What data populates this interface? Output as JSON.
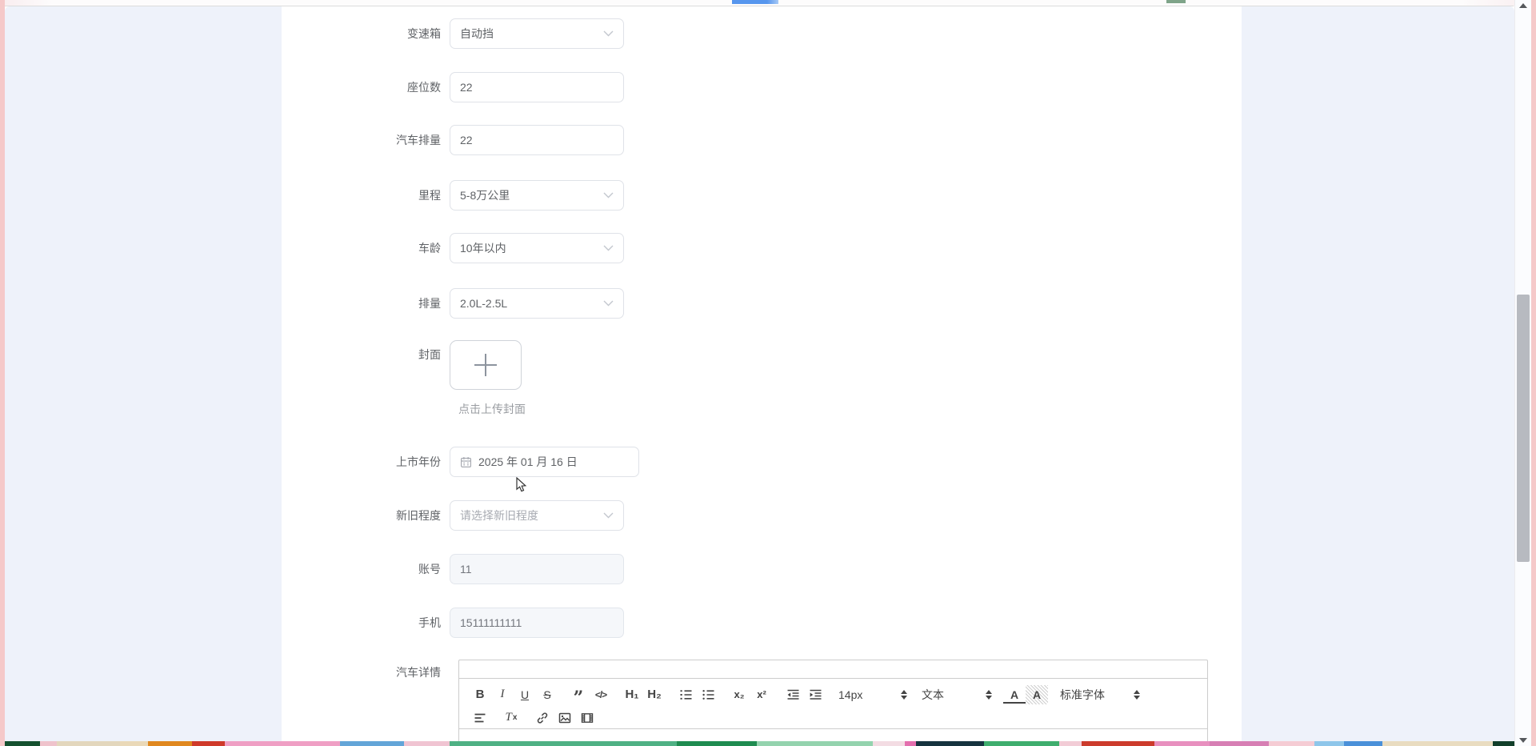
{
  "colors": {
    "panel_accent": "#eef2fa",
    "frame_pink": "#f5c9c9",
    "top_bar_blue": "#5796ee",
    "scrollbar_thumb": "#b7bac0",
    "input_border": "#dfe2e8",
    "disabled_bg": "#f5f7fa"
  },
  "form": {
    "transmission": {
      "label": "变速箱",
      "value": "自动挡"
    },
    "seats": {
      "label": "座位数",
      "value": "22"
    },
    "engine_displacement": {
      "label": "汽车排量",
      "value": "22"
    },
    "mileage": {
      "label": "里程",
      "value": "5-8万公里"
    },
    "car_age": {
      "label": "车龄",
      "value": "10年以内"
    },
    "displacement_range": {
      "label": "排量",
      "value": "2.0L-2.5L"
    },
    "cover": {
      "label": "封面",
      "hint": "点击上传封面"
    },
    "market_year": {
      "label": "上市年份",
      "value": "2025 年 01 月 16 日"
    },
    "condition": {
      "label": "新旧程度",
      "placeholder": "请选择新旧程度"
    },
    "account": {
      "label": "账号",
      "value": "11"
    },
    "phone": {
      "label": "手机",
      "value": "15111111111"
    },
    "car_detail": {
      "label": "汽车详情"
    }
  },
  "editor": {
    "toolbar": {
      "bold": "B",
      "italic": "I",
      "underline": "U",
      "strike": "S",
      "blockquote": "”",
      "code": "</>",
      "h1": "H₁",
      "h2": "H₂",
      "subscript": "x₂",
      "superscript": "x²",
      "size": "14px",
      "header": "文本",
      "color_letter": "A",
      "background_letter": "A",
      "font": "标准字体",
      "clean_t": "T",
      "clean_x": "x"
    }
  },
  "bottom_strip": {
    "segments": [
      {
        "to": 50,
        "color": "#15512f"
      },
      {
        "to": 71,
        "color": "#efc3cc"
      },
      {
        "to": 150,
        "color": "#e3d7bd"
      },
      {
        "to": 185,
        "color": "#ead9b8"
      },
      {
        "to": 240,
        "color": "#e0881f"
      },
      {
        "to": 281,
        "color": "#cf3a2a"
      },
      {
        "to": 425,
        "color": "#ef9fc4"
      },
      {
        "to": 505,
        "color": "#63a5d8"
      },
      {
        "to": 562,
        "color": "#f0c4d2"
      },
      {
        "to": 846,
        "color": "#4fb184"
      },
      {
        "to": 946,
        "color": "#1f8c50"
      },
      {
        "to": 1091,
        "color": "#94d3ae"
      },
      {
        "to": 1131,
        "color": "#f3dce3"
      },
      {
        "to": 1145,
        "color": "#e46fae"
      },
      {
        "to": 1230,
        "color": "#16333f"
      },
      {
        "to": 1324,
        "color": "#3fae6e"
      },
      {
        "to": 1352,
        "color": "#f2ccd6"
      },
      {
        "to": 1443,
        "color": "#cc3b2c"
      },
      {
        "to": 1512,
        "color": "#e890bf"
      },
      {
        "to": 1586,
        "color": "#d77fb4"
      },
      {
        "to": 1643,
        "color": "#f5ccd4"
      },
      {
        "to": 1680,
        "color": "#8ec6ea"
      },
      {
        "to": 1728,
        "color": "#4a90d9"
      },
      {
        "to": 1866,
        "color": "#e9dcc0"
      },
      {
        "to": 1893,
        "color": "#123f2a"
      }
    ]
  }
}
